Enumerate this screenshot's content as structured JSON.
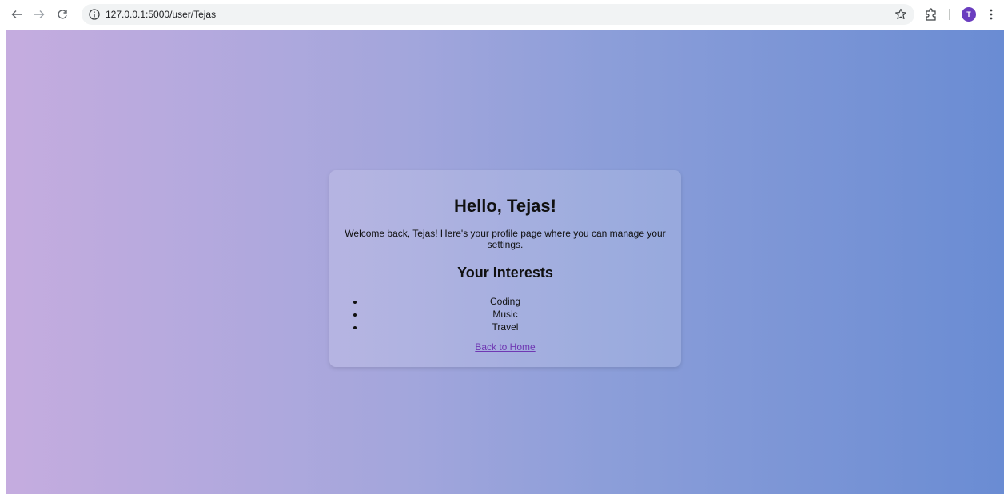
{
  "browser": {
    "url": "127.0.0.1:5000/user/Tejas",
    "avatar_initial": "T",
    "back_icon": "arrow-left-icon",
    "forward_icon": "arrow-right-icon",
    "reload_icon": "reload-icon",
    "bookmark_icon": "star-icon",
    "extensions_icon": "puzzle-icon",
    "menu_icon": "kebab-menu-icon"
  },
  "page": {
    "heading": "Hello, Tejas!",
    "welcome_text": "Welcome back, Tejas! Here's your profile page where you can manage your settings.",
    "interests_heading": "Your Interests",
    "interests": [
      "Coding",
      "Music",
      "Travel"
    ],
    "back_link": "Back to Home"
  },
  "colors": {
    "gradient_start": "#c5acdf",
    "gradient_end": "#6a8cd3",
    "link": "#6f38b3",
    "avatar": "#6a3dbf"
  }
}
